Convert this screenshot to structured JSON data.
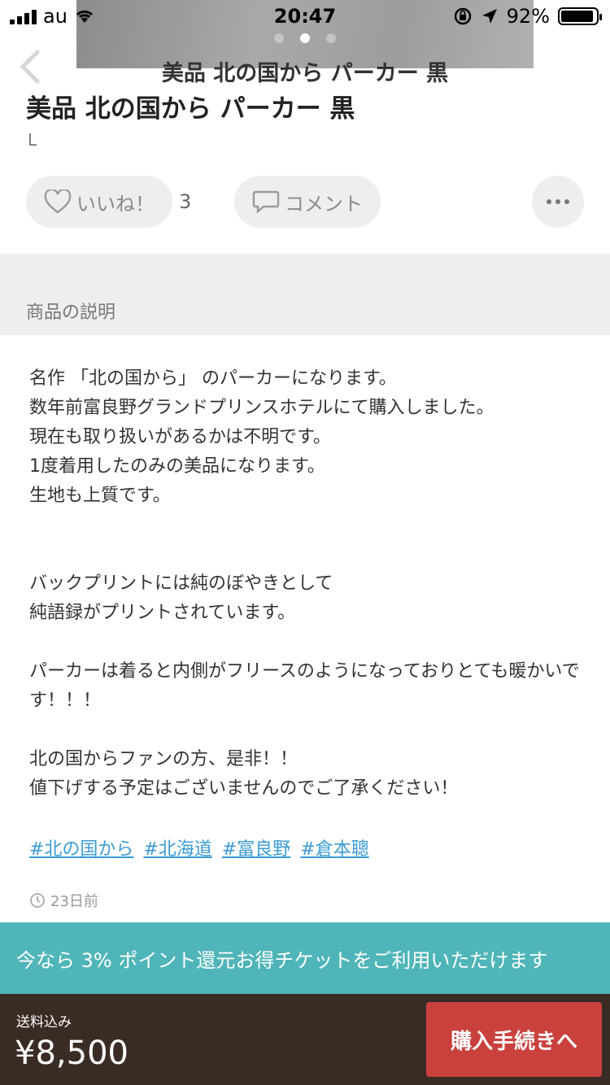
{
  "status_bar": {
    "carrier": "au",
    "time": "20:47",
    "battery_percent": "92%",
    "battery_level": 0.92
  },
  "header": {
    "title": "美品 北の国から パーカー 黒",
    "back_icon": "chevron-left-icon"
  },
  "item": {
    "title": "美品 北の国から パーカー 黒",
    "size": "L"
  },
  "actions": {
    "like_label": "いいね！",
    "like_count": "3",
    "comment_label": "コメント",
    "more_icon": "more-horizontal-icon"
  },
  "description": {
    "section_title": "商品の説明",
    "paragraphs": [
      "名作 「北の国から」 のパーカーになります。\n数年前富良野グランドプリンスホテルにて購入しました。\n現在も取り扱いがあるかは不明です。\n1度着用したのみの美品になります。\n生地も上質です。",
      "バックプリントには純のぼやきとして\n純語録がプリントされています。",
      "パーカーは着ると内側がフリースのようになっておりとても暖かいです！！！",
      "北の国からファンの方、是非！！\n値下げする予定はございませんのでご了承ください！"
    ],
    "tags": [
      "#北の国から",
      "#北海道",
      "#富良野",
      "#倉本聰"
    ],
    "posted": "23日前"
  },
  "promo": {
    "text": "今なら 3% ポイント還元お得チケットをご利用いただけます"
  },
  "purchase": {
    "shipping_label": "送料込み",
    "price": "¥8,500",
    "button_label": "購入手続きへ"
  },
  "colors": {
    "promo_bg": "#4fb5b8",
    "purchase_bg": "#3a2b25",
    "buy_button": "#c9403d",
    "tag_link": "#3a9bd6"
  }
}
